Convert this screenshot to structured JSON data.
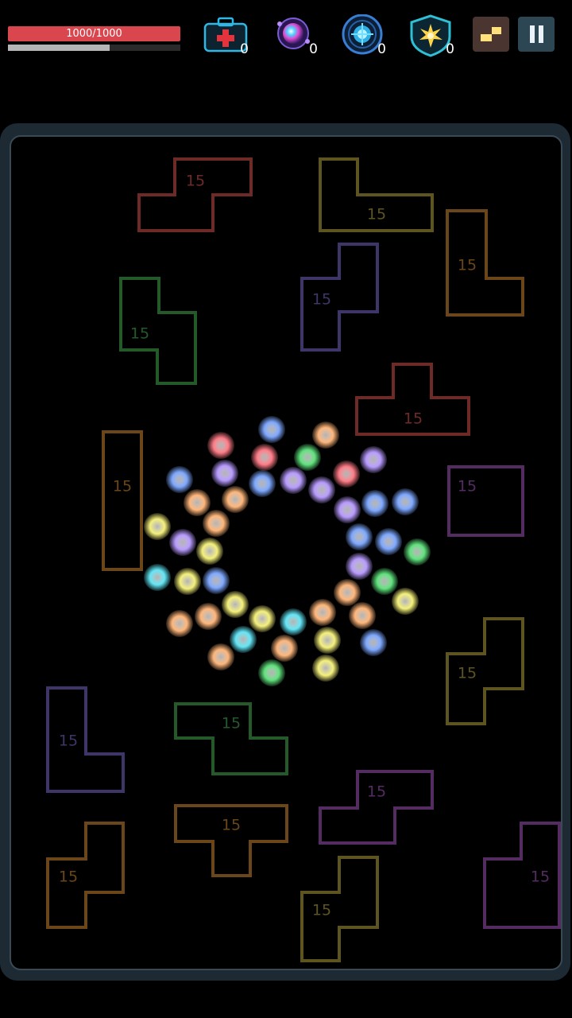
{
  "hud": {
    "hp_text": "1000/1000",
    "hp_fraction": 1.0,
    "shield_fraction": 0.59,
    "powerups": [
      {
        "name": "medkit",
        "count": "0"
      },
      {
        "name": "rainbow-orb",
        "count": "0"
      },
      {
        "name": "ice-orb",
        "count": "0"
      },
      {
        "name": "shield-burst",
        "count": "0"
      }
    ]
  },
  "blocks": {
    "hit_label": "15"
  },
  "colors": {
    "hp": "#d9464e",
    "red": "#6e2a27",
    "olive": "#5e5420",
    "orange": "#6a4618",
    "green": "#245a2a",
    "purple": "#3f3568",
    "violet": "#552c62"
  }
}
